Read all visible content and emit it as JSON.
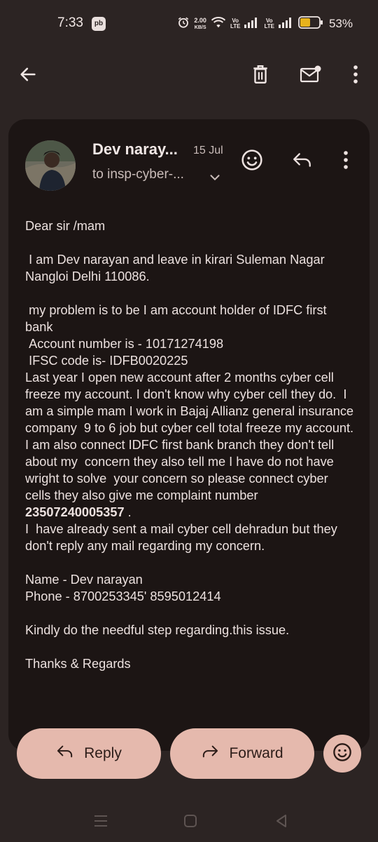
{
  "status_bar": {
    "time": "7:33",
    "notification_badge": "pb",
    "net_speed_value": "2.00",
    "net_speed_unit": "KB/S",
    "volte_top": "Vo",
    "volte_bottom": "LTE",
    "volte_top2": "Vo",
    "volte_bottom2": "LTE",
    "battery_percent": "53%",
    "battery_level": 0.53,
    "battery_color": "#e7b21c"
  },
  "toolbar": {
    "back_icon": "arrow-back-icon",
    "delete_icon": "delete-icon",
    "mark_unread_icon": "mail-unread-icon",
    "more_icon": "more-vert-icon"
  },
  "email": {
    "sender": "Dev naray...",
    "date": "15 Jul",
    "recipient": "to insp-cyber-...",
    "body": [
      "Dear sir /mam",
      "",
      " I am Dev narayan and leave in kirari Suleman Nagar Nangloi Delhi 110086.",
      "",
      " my problem is to be I am account holder of IDFC first bank",
      " Account number is - 10171274198",
      " IFSC code is- IDFB0020225",
      "Last year I open new account after 2 months cyber cell  freeze my account. I don't know why cyber cell they do.  I am a simple mam I work in Bajaj Allianz general insurance company  9 to 6 job but cyber cell total freeze my account."
    ],
    "body_concern_prefix": "I am also connect IDFC first bank branch they don't tell about my  concern they also tell me I have do not have  wright to solve  your concern so please connect cyber cells they also give me complaint number ",
    "complaint_number": "23507240005357",
    "body_concern_suffix": " .",
    "body_tail": [
      "I  have already sent a mail cyber cell dehradun but they don't reply any mail regarding my concern.",
      "",
      "Name - Dev narayan",
      "Phone - 8700253345' 8595012414",
      "",
      "Kindly do the needful step regarding.this issue.",
      "",
      "Thanks & Regards"
    ]
  },
  "actions": {
    "reply_label": "Reply",
    "forward_label": "Forward"
  },
  "colors": {
    "background": "#2c2423",
    "card": "#1c1514",
    "button": "#e5b9ad"
  }
}
